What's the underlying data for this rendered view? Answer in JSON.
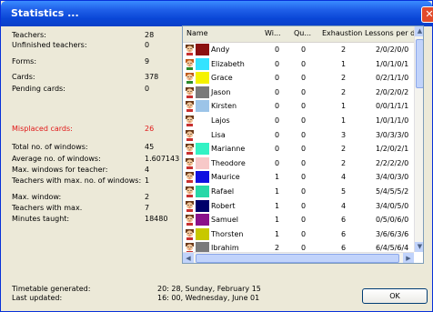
{
  "window": {
    "title": "Statistics ...",
    "close_glyph": "✕"
  },
  "stats": [
    {
      "label": "Teachers:",
      "value": "28"
    },
    {
      "label": "Unfinished teachers:",
      "value": "0"
    },
    {
      "label": "Forms:",
      "value": "9"
    },
    {
      "label": "Cards:",
      "value": "378"
    },
    {
      "label": "Pending cards:",
      "value": "0"
    },
    {
      "label": "Misplaced cards:",
      "value": "26"
    },
    {
      "label": "Total no. of  windows:",
      "value": "45"
    },
    {
      "label": "Average no. of windows:",
      "value": "1.607143"
    },
    {
      "label": "Max. windows for teacher:",
      "value": "4"
    },
    {
      "label": "Teachers with max. no. of windows:",
      "value": "1"
    },
    {
      "label": "Max. window:",
      "value": "2"
    },
    {
      "label": "Teachers with max.",
      "value": "7"
    },
    {
      "label": "Minutes taught:",
      "value": "18480"
    }
  ],
  "footer": {
    "generated_label": "Timetable generated:",
    "generated_value": "20: 28, Sunday, February 15",
    "updated_label": "Last updated:",
    "updated_value": "16: 00, Wednesday, June 01"
  },
  "table": {
    "columns": [
      "Name",
      "Wi...",
      "Qu...",
      "Exhaustion",
      "Lessons per day"
    ],
    "rows": [
      {
        "name": "Andy",
        "color": "#8b1010",
        "face": "male",
        "wi": "0",
        "qu": "0",
        "ex": "2",
        "lpd": "2/0/2/0/0"
      },
      {
        "name": "Elizabeth",
        "color": "#33e3ff",
        "face": "female",
        "wi": "0",
        "qu": "0",
        "ex": "1",
        "lpd": "1/0/1/0/1"
      },
      {
        "name": "Grace",
        "color": "#f5f200",
        "face": "female",
        "wi": "0",
        "qu": "0",
        "ex": "2",
        "lpd": "0/2/1/1/0"
      },
      {
        "name": "Jason",
        "color": "#7a7a7a",
        "face": "male",
        "wi": "0",
        "qu": "0",
        "ex": "2",
        "lpd": "2/0/2/0/2"
      },
      {
        "name": "Kirsten",
        "color": "#9cc4e8",
        "face": "male",
        "wi": "0",
        "qu": "0",
        "ex": "1",
        "lpd": "0/0/1/1/1"
      },
      {
        "name": "Lajos",
        "color": "#ffffff",
        "face": "male",
        "wi": "0",
        "qu": "0",
        "ex": "1",
        "lpd": "1/0/1/1/0"
      },
      {
        "name": "Lisa",
        "color": "#ffffff",
        "face": "male",
        "wi": "0",
        "qu": "0",
        "ex": "3",
        "lpd": "3/0/3/3/0"
      },
      {
        "name": "Marianne",
        "color": "#33f2c4",
        "face": "male",
        "wi": "0",
        "qu": "0",
        "ex": "2",
        "lpd": "1/2/0/2/1"
      },
      {
        "name": "Theodore",
        "color": "#f7c8c8",
        "face": "male",
        "wi": "0",
        "qu": "0",
        "ex": "2",
        "lpd": "2/2/2/2/0"
      },
      {
        "name": "Maurice",
        "color": "#1010e0",
        "face": "male",
        "wi": "1",
        "qu": "0",
        "ex": "4",
        "lpd": "3/4/0/3/0"
      },
      {
        "name": "Rafael",
        "color": "#28d8a8",
        "face": "male",
        "wi": "1",
        "qu": "0",
        "ex": "5",
        "lpd": "5/4/5/5/2"
      },
      {
        "name": "Robert",
        "color": "#00006a",
        "face": "male",
        "wi": "1",
        "qu": "0",
        "ex": "4",
        "lpd": "3/4/0/5/0"
      },
      {
        "name": "Samuel",
        "color": "#8a108a",
        "face": "male",
        "wi": "1",
        "qu": "0",
        "ex": "6",
        "lpd": "0/5/0/6/0"
      },
      {
        "name": "Thorsten",
        "color": "#c8c800",
        "face": "male",
        "wi": "1",
        "qu": "0",
        "ex": "6",
        "lpd": "3/6/6/3/6"
      },
      {
        "name": "Ibrahim",
        "color": "#7a7a7a",
        "face": "male",
        "wi": "2",
        "qu": "0",
        "ex": "6",
        "lpd": "6/4/5/6/4"
      }
    ]
  },
  "buttons": {
    "ok": "OK"
  },
  "icons": {
    "person": "teacher-portrait-icon",
    "up": "▲",
    "down": "▼",
    "left": "◀",
    "right": "▶"
  }
}
